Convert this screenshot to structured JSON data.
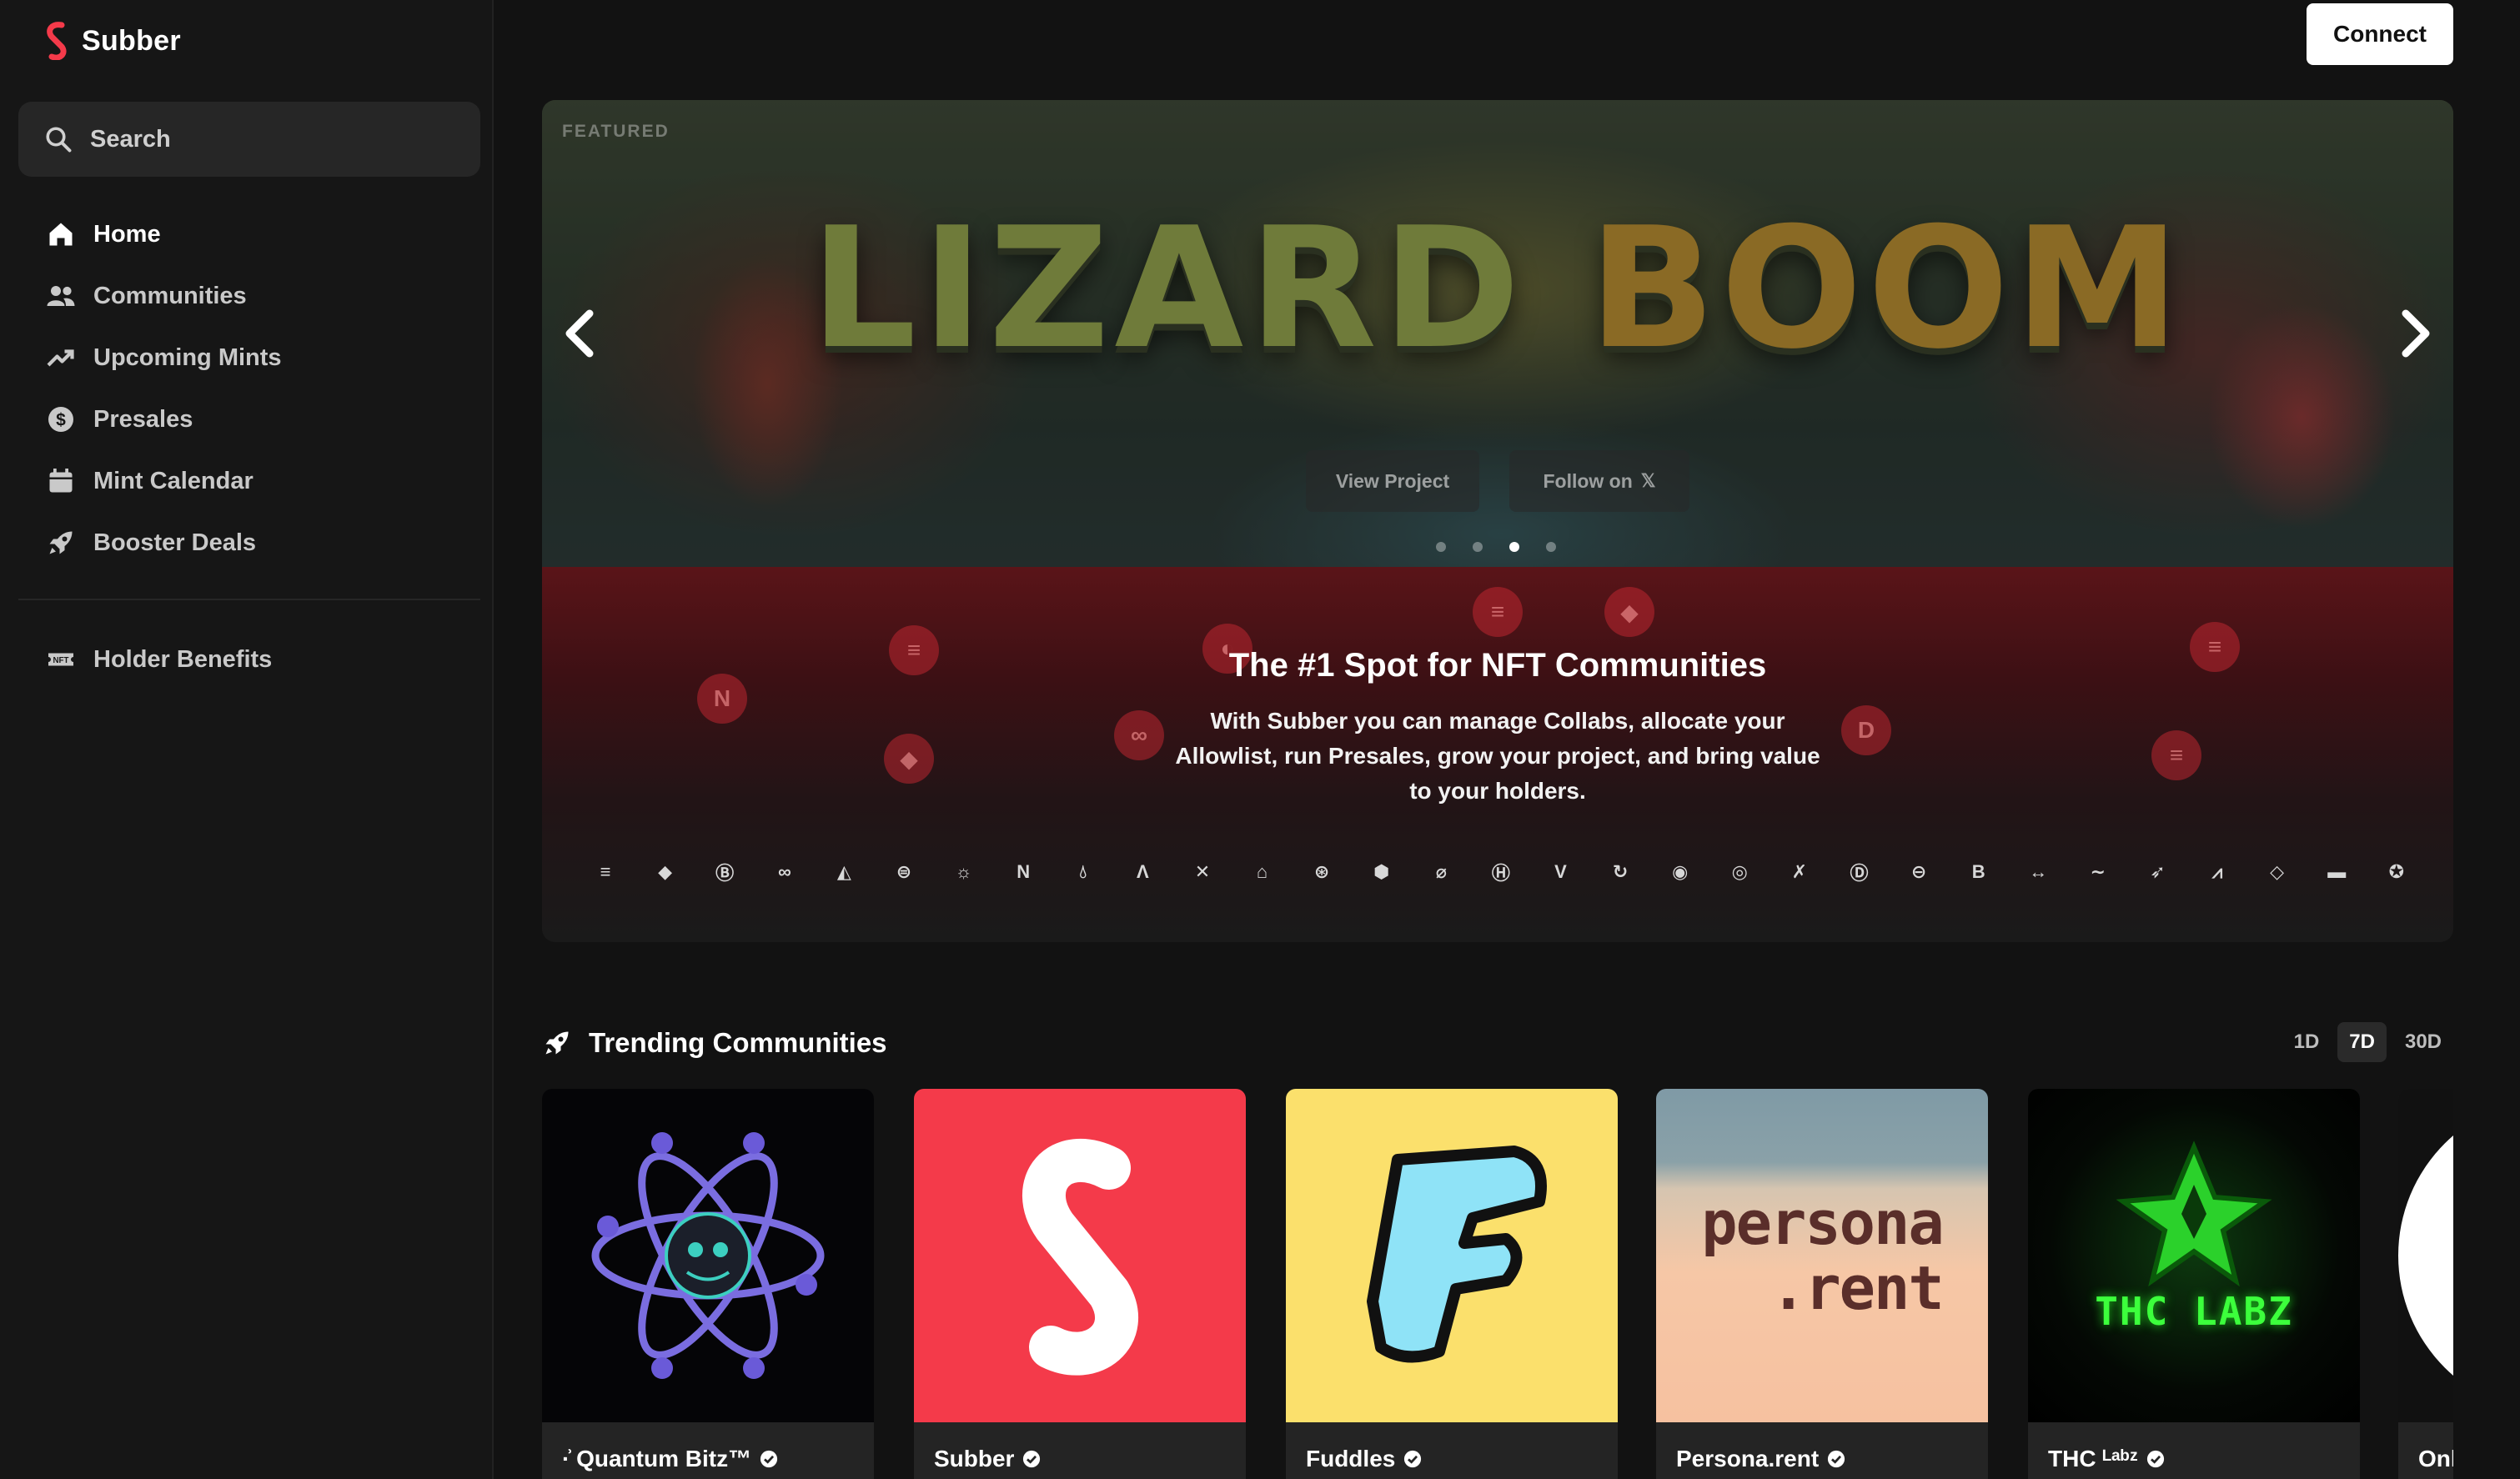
{
  "app": {
    "name": "Subber",
    "brand_color": "#f43a4a"
  },
  "header": {
    "connect_label": "Connect"
  },
  "search": {
    "placeholder": "Search"
  },
  "sidebar": {
    "items": [
      {
        "label": "Home",
        "icon": "home-icon",
        "active": true
      },
      {
        "label": "Communities",
        "icon": "users-icon"
      },
      {
        "label": "Upcoming Mints",
        "icon": "trending-up-icon"
      },
      {
        "label": "Presales",
        "icon": "dollar-circle-icon"
      },
      {
        "label": "Mint Calendar",
        "icon": "calendar-icon"
      },
      {
        "label": "Booster Deals",
        "icon": "rocket-icon"
      }
    ],
    "secondary": [
      {
        "label": "Holder Benefits",
        "icon": "nft-ticket-icon"
      }
    ]
  },
  "hero": {
    "featured_label": "FEATURED",
    "banner_title_a": "LIZARD",
    "banner_title_b": "BOOM",
    "view_project_label": "View Project",
    "follow_label": "Follow on",
    "follow_icon": "x-logo",
    "slides": 4,
    "active_slide": 3,
    "promo_title": "The #1 Spot for NFT Communities",
    "promo_text": "With Subber you can manage Collabs, allocate your Allowlist, run Presales, grow your project, and bring value to your holders.",
    "chain_icons": [
      "solana-icon",
      "ethereum-icon",
      "bitcoin-icon",
      "polygon-icon",
      "arbitrum-icon",
      "sei-icon",
      "sun-icon",
      "near-icon",
      "drop-icon",
      "aptos-icon",
      "cross-icon",
      "arch-icon",
      "sphere-icon",
      "cube-icon",
      "slash-icon",
      "hedera-icon",
      "v-icon",
      "ring-icon",
      "coin-icon",
      "swirl-icon",
      "x-chain-icon",
      "d-icon",
      "minus-circle-icon",
      "b-icon",
      "arrows-icon",
      "wave-icon",
      "feather-icon",
      "zigzag-icon",
      "diamond-icon",
      "pill-icon",
      "star-circle-icon"
    ]
  },
  "trending": {
    "title": "Trending Communities",
    "ranges": [
      "1D",
      "7D",
      "30D"
    ],
    "active_range": "7D",
    "communities": [
      {
        "name": "·͗ Quantum Bitz™",
        "verified": true
      },
      {
        "name": "Subber",
        "verified": true
      },
      {
        "name": "Fuddles",
        "verified": true
      },
      {
        "name": "Persona.rent",
        "verified": true,
        "art_text_1": "persona",
        "art_text_2": ".rent"
      },
      {
        "name": "THC ᴸᵃᵇᶻ",
        "verified": true,
        "art_text": "THC LABZ"
      },
      {
        "name": "Onl",
        "verified": false
      }
    ]
  }
}
